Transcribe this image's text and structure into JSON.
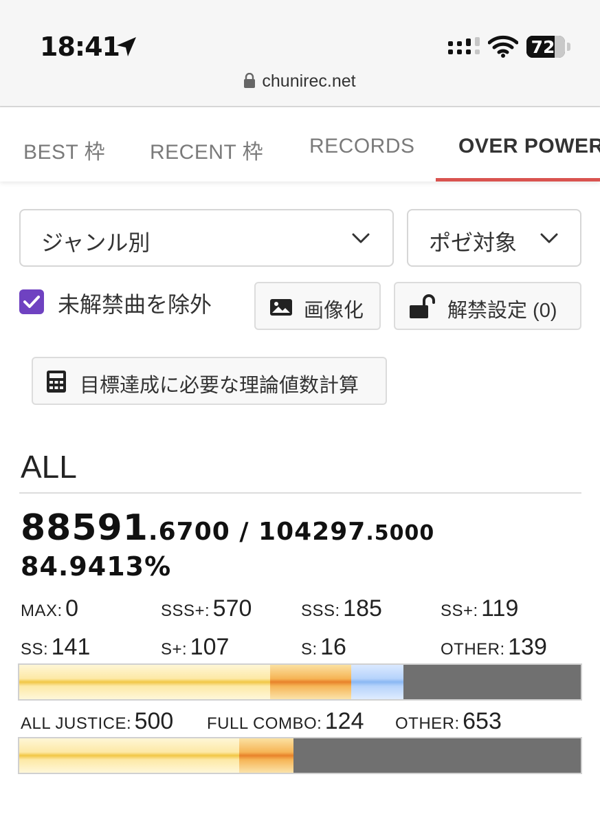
{
  "status_bar": {
    "time": "18:41",
    "battery": "72"
  },
  "address_bar": {
    "url": "chunirec.net"
  },
  "tabs": [
    {
      "label": "BEST 枠"
    },
    {
      "label": "RECENT 枠"
    },
    {
      "label": "RECORDS"
    },
    {
      "label": "OVER POWER",
      "active": true
    }
  ],
  "filters": {
    "genre_select": "ジャンル別",
    "target_select": "ポゼ対象",
    "exclude_locked_label": "未解禁曲を除外",
    "exclude_locked_checked": true
  },
  "buttons": {
    "image": "画像化",
    "unlock": "解禁設定 (0)",
    "calc": "目標達成に必要な理論値数計算"
  },
  "section": {
    "title": "ALL",
    "score_int": "88591",
    "score_frac": ".6700",
    "score_sep": " / ",
    "max_int": "104297",
    "max_frac": ".5000",
    "percent": "84.9413%"
  },
  "rank_counts": [
    {
      "label": "MAX:",
      "value": "0"
    },
    {
      "label": "SSS+:",
      "value": "570"
    },
    {
      "label": "SSS:",
      "value": "185"
    },
    {
      "label": "SS+:",
      "value": "119"
    },
    {
      "label": "SS:",
      "value": "141"
    },
    {
      "label": "S+:",
      "value": "107"
    },
    {
      "label": "S:",
      "value": "16"
    },
    {
      "label": "OTHER:",
      "value": "139"
    }
  ],
  "rank_bar": [
    {
      "name": "sss-plus",
      "value": 570,
      "color": "#fde9a6"
    },
    {
      "name": "sss",
      "value": 185,
      "color": "#f6b556"
    },
    {
      "name": "ss-plus",
      "value": 119,
      "color": "#b6d3fb"
    },
    {
      "name": "ss",
      "value": 141,
      "color": "#707070"
    },
    {
      "name": "s-plus",
      "value": 107,
      "color": "#707070"
    },
    {
      "name": "s",
      "value": 16,
      "color": "#707070"
    },
    {
      "name": "other",
      "value": 139,
      "color": "#707070"
    }
  ],
  "combo_counts": [
    {
      "label": "ALL JUSTICE:",
      "value": "500"
    },
    {
      "label": "FULL COMBO:",
      "value": "124"
    },
    {
      "label": "OTHER:",
      "value": "653"
    }
  ],
  "combo_bar": [
    {
      "name": "all-justice",
      "value": 500,
      "color": "#fde9a6"
    },
    {
      "name": "full-combo",
      "value": 124,
      "color": "#f6b556"
    },
    {
      "name": "other",
      "value": 653,
      "color": "#707070"
    }
  ],
  "colors": {
    "accent": "#d9534f",
    "checkbox": "#6f42c1"
  }
}
